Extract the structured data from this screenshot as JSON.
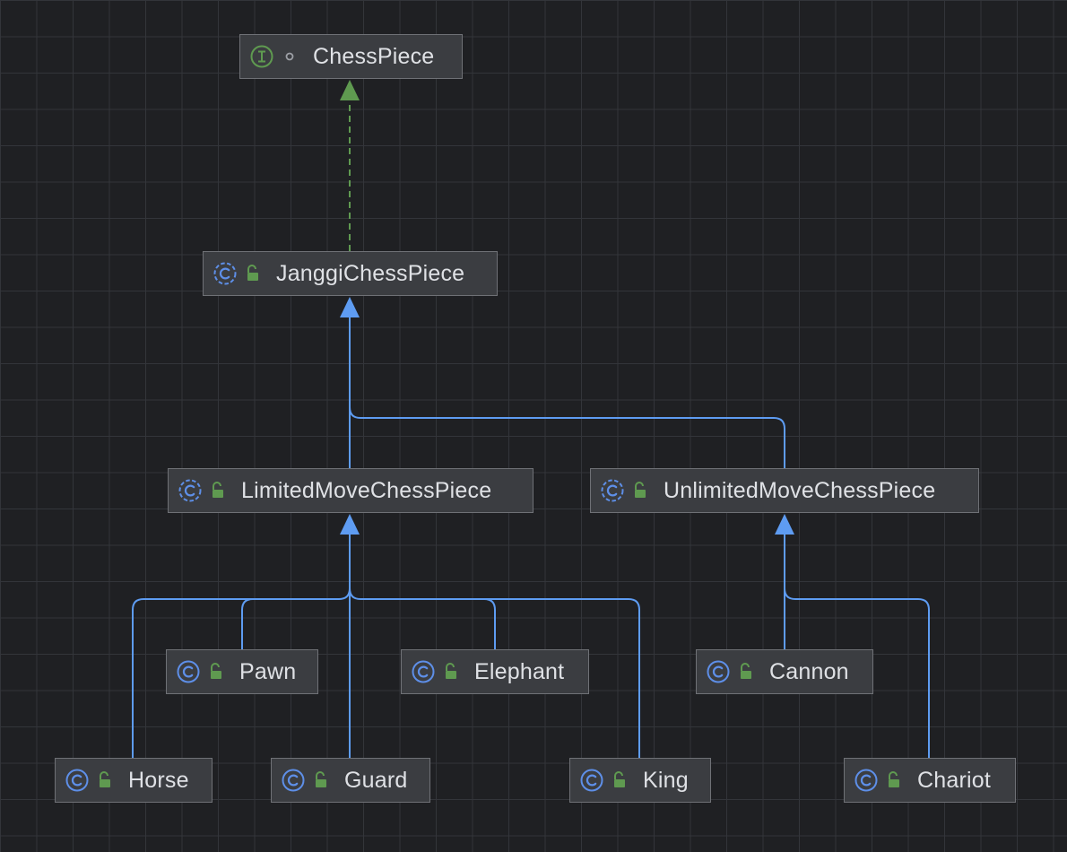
{
  "diagram": {
    "colors": {
      "background": "#1f2023",
      "grid": "#33353a",
      "node_fill": "#3b3d41",
      "node_border": "#6f7176",
      "text": "#dfe1e5",
      "inheritance_edge": "#5e9cf2",
      "implementation_edge": "#5f9a50",
      "class_icon": "#5e8fe8",
      "interface_icon": "#5f9a50",
      "public_lock_icon": "#5f9a50"
    },
    "nodes": [
      {
        "id": "chesspiece",
        "label": "ChessPiece",
        "kind": "interface",
        "kind_icon": "interface-icon",
        "visibility_icon": "circle-dot-icon"
      },
      {
        "id": "janggi",
        "label": "JanggiChessPiece",
        "kind": "abstract-class",
        "kind_icon": "abstract-class-icon",
        "visibility_icon": "lock-open-icon"
      },
      {
        "id": "limited",
        "label": "LimitedMoveChessPiece",
        "kind": "abstract-class",
        "kind_icon": "abstract-class-icon",
        "visibility_icon": "lock-open-icon"
      },
      {
        "id": "unlimited",
        "label": "UnlimitedMoveChessPiece",
        "kind": "abstract-class",
        "kind_icon": "abstract-class-icon",
        "visibility_icon": "lock-open-icon"
      },
      {
        "id": "pawn",
        "label": "Pawn",
        "kind": "class",
        "kind_icon": "class-icon",
        "visibility_icon": "lock-open-icon"
      },
      {
        "id": "elephant",
        "label": "Elephant",
        "kind": "class",
        "kind_icon": "class-icon",
        "visibility_icon": "lock-open-icon"
      },
      {
        "id": "cannon",
        "label": "Cannon",
        "kind": "class",
        "kind_icon": "class-icon",
        "visibility_icon": "lock-open-icon"
      },
      {
        "id": "horse",
        "label": "Horse",
        "kind": "class",
        "kind_icon": "class-icon",
        "visibility_icon": "lock-open-icon"
      },
      {
        "id": "guard",
        "label": "Guard",
        "kind": "class",
        "kind_icon": "class-icon",
        "visibility_icon": "lock-open-icon"
      },
      {
        "id": "king",
        "label": "King",
        "kind": "class",
        "kind_icon": "class-icon",
        "visibility_icon": "lock-open-icon"
      },
      {
        "id": "chariot",
        "label": "Chariot",
        "kind": "class",
        "kind_icon": "class-icon",
        "visibility_icon": "lock-open-icon"
      }
    ],
    "edges": [
      {
        "from": "janggi",
        "to": "chesspiece",
        "type": "implements"
      },
      {
        "from": "limited",
        "to": "janggi",
        "type": "extends"
      },
      {
        "from": "unlimited",
        "to": "janggi",
        "type": "extends"
      },
      {
        "from": "horse",
        "to": "limited",
        "type": "extends"
      },
      {
        "from": "pawn",
        "to": "limited",
        "type": "extends"
      },
      {
        "from": "guard",
        "to": "limited",
        "type": "extends"
      },
      {
        "from": "elephant",
        "to": "limited",
        "type": "extends"
      },
      {
        "from": "king",
        "to": "limited",
        "type": "extends"
      },
      {
        "from": "cannon",
        "to": "unlimited",
        "type": "extends"
      },
      {
        "from": "chariot",
        "to": "unlimited",
        "type": "extends"
      }
    ]
  }
}
